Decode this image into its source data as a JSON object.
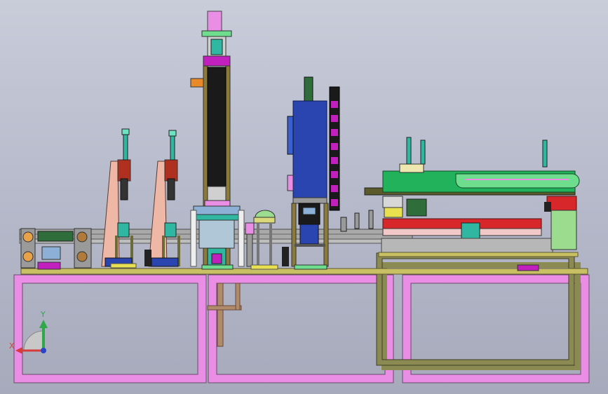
{
  "view": {
    "background_top": "#c9ccd9",
    "background_bottom": "#a6aabb"
  },
  "colors": {
    "frame_pink": "#e98ee4",
    "frame_olive": "#8b8a52",
    "tower_blue": "#2b45b0",
    "tower_black": "#1a1a1a",
    "gantry_green": "#23b25c",
    "fixture_salmon": "#eeb7a6",
    "rail_gray": "#a9a9a9",
    "accent_red": "#d8272b",
    "accent_magenta": "#c21fbf",
    "accent_orange": "#e98a2a",
    "accent_teal": "#2fb7a1",
    "accent_yellow": "#e9e04f"
  },
  "axis_triad": {
    "x_label": "X",
    "y_label": "Y",
    "x_color": "#d63c3c",
    "y_color": "#2fa84a",
    "z_color": "#2a44c9"
  }
}
